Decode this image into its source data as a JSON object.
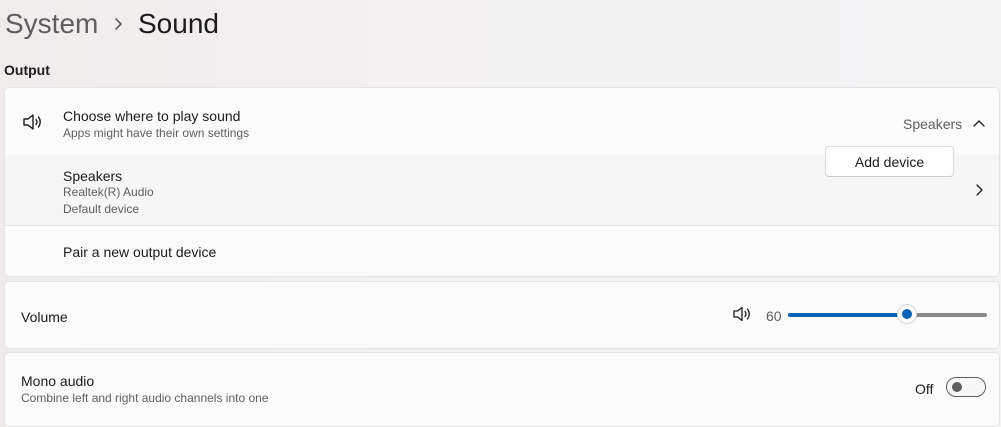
{
  "breadcrumb": {
    "parent": "System",
    "current": "Sound"
  },
  "output": {
    "section_label": "Output",
    "choose": {
      "title": "Choose where to play sound",
      "subtitle": "Apps might have their own settings",
      "selected": "Speakers",
      "icon": "speaker-icon",
      "expanded": true
    },
    "speakers": {
      "title": "Speakers",
      "line1": "Realtek(R) Audio",
      "line2": "Default device"
    },
    "pair": {
      "title": "Pair a new output device",
      "button_label": "Add device"
    }
  },
  "volume": {
    "label": "Volume",
    "value_text": "60",
    "value": 60,
    "max": 100,
    "icon": "speaker-icon",
    "accent_color": "#0a62b5"
  },
  "mono": {
    "title": "Mono audio",
    "subtitle": "Combine left and right audio channels into one",
    "state_label": "Off",
    "on": false
  }
}
